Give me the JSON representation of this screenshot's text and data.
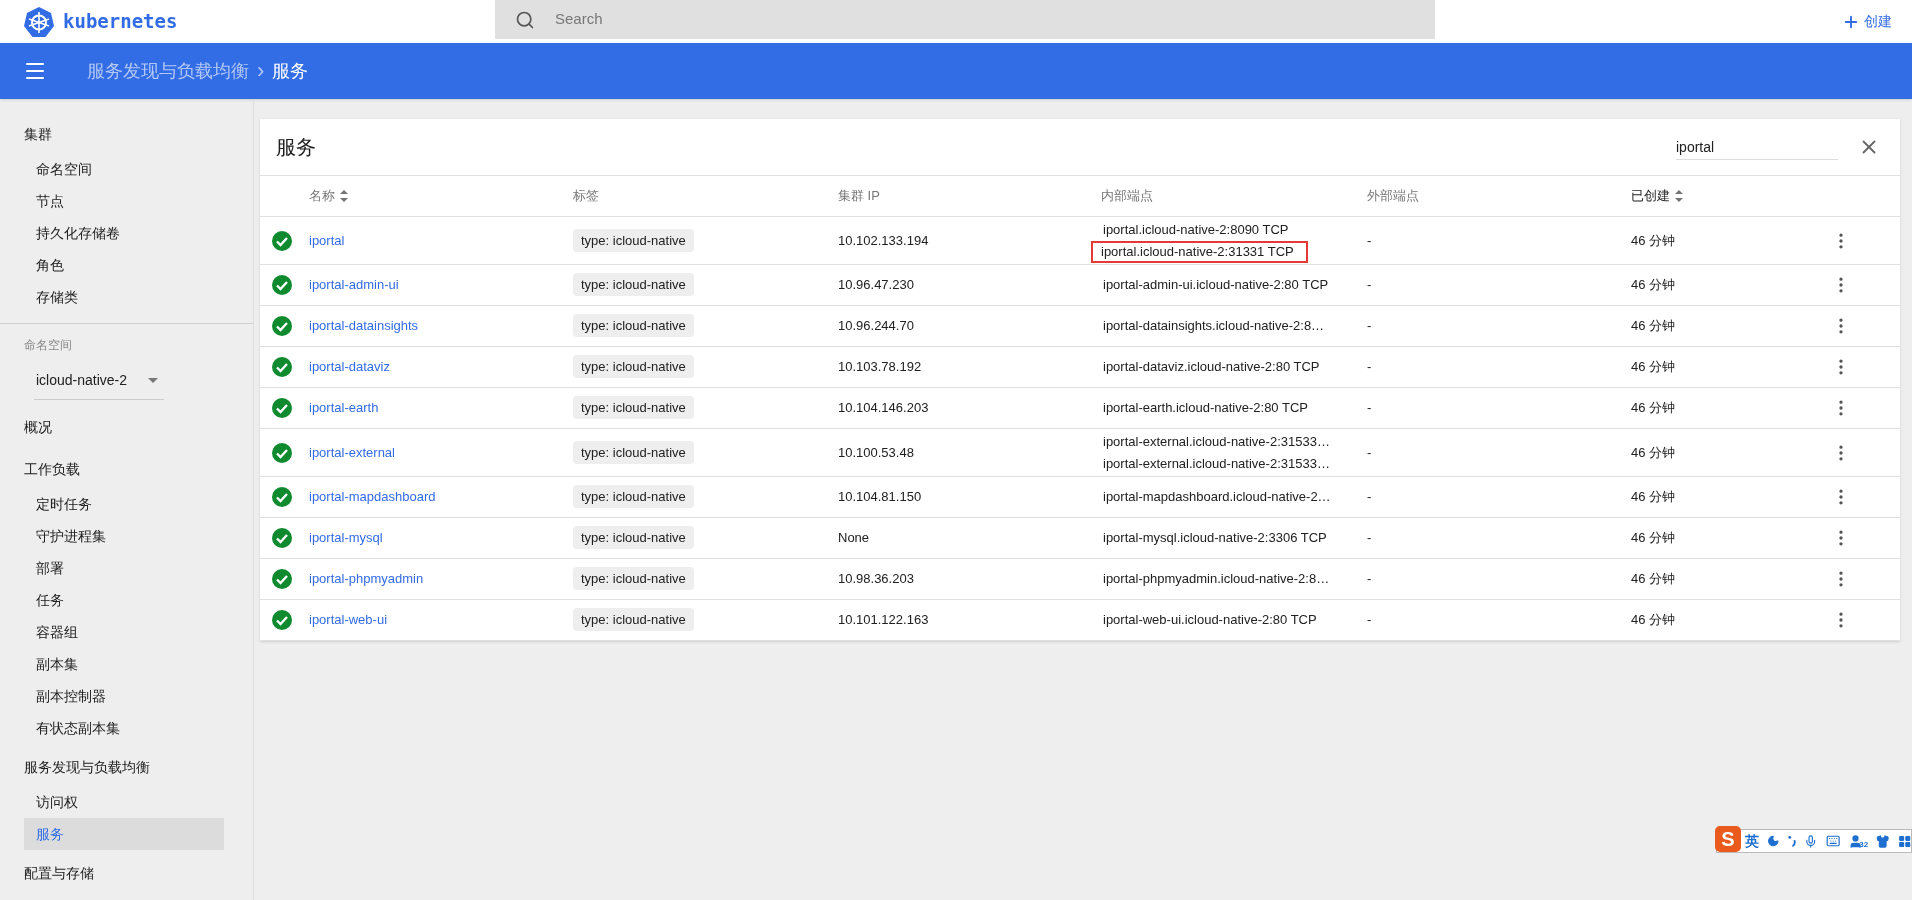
{
  "topbar": {
    "brand": "kubernetes",
    "search": {
      "placeholder": "Search"
    },
    "create": "创建"
  },
  "breadcrumb": {
    "parent": "服务发现与负载均衡",
    "separator": "›",
    "current": "服务"
  },
  "sidebar": {
    "groups": [
      {
        "kind": "section",
        "label": "集群",
        "children": [
          {
            "label": "命名空间",
            "selected": false
          },
          {
            "label": "节点",
            "selected": false
          },
          {
            "label": "持久化存储卷",
            "selected": false
          },
          {
            "label": "角色",
            "selected": false
          },
          {
            "label": "存储类",
            "selected": false
          }
        ]
      },
      {
        "kind": "namespace",
        "label": "命名空间",
        "value": "icloud-native-2"
      },
      {
        "kind": "section",
        "label": "概况"
      },
      {
        "kind": "section",
        "label": "工作负载",
        "children": [
          {
            "label": "定时任务",
            "selected": false
          },
          {
            "label": "守护进程集",
            "selected": false
          },
          {
            "label": "部署",
            "selected": false
          },
          {
            "label": "任务",
            "selected": false
          },
          {
            "label": "容器组",
            "selected": false
          },
          {
            "label": "副本集",
            "selected": false
          },
          {
            "label": "副本控制器",
            "selected": false
          },
          {
            "label": "有状态副本集",
            "selected": false
          }
        ]
      },
      {
        "kind": "section",
        "label": "服务发现与负载均衡",
        "children": [
          {
            "label": "访问权",
            "selected": false
          },
          {
            "label": "服务",
            "selected": true
          }
        ]
      },
      {
        "kind": "section",
        "label": "配置与存储"
      }
    ]
  },
  "card": {
    "title": "服务",
    "filter": {
      "value": "iportal"
    },
    "columns": [
      {
        "label": "名称",
        "sortable": true
      },
      {
        "label": "标签",
        "sortable": false
      },
      {
        "label": "集群 IP",
        "sortable": false
      },
      {
        "label": "内部端点",
        "sortable": false
      },
      {
        "label": "外部端点",
        "sortable": false
      },
      {
        "label": "已创建",
        "sortable": true
      }
    ],
    "rows": [
      {
        "healthy": true,
        "name": "iportal",
        "label": "type: icloud-native",
        "ip": "10.102.133.194",
        "endpoints": [
          {
            "text": "iportal.icloud-native-2:8090 TCP",
            "highlighted": false
          },
          {
            "text": "iportal.icloud-native-2:31331 TCP",
            "highlighted": true
          }
        ],
        "external": "-",
        "created": "46 分钟"
      },
      {
        "healthy": true,
        "name": "iportal-admin-ui",
        "label": "type: icloud-native",
        "ip": "10.96.47.230",
        "endpoints": [
          {
            "text": "iportal-admin-ui.icloud-native-2:80 TCP",
            "highlighted": false
          }
        ],
        "external": "-",
        "created": "46 分钟"
      },
      {
        "healthy": true,
        "name": "iportal-datainsights",
        "label": "type: icloud-native",
        "ip": "10.96.244.70",
        "endpoints": [
          {
            "text": "iportal-datainsights.icloud-native-2:8…",
            "highlighted": false
          }
        ],
        "external": "-",
        "created": "46 分钟"
      },
      {
        "healthy": true,
        "name": "iportal-dataviz",
        "label": "type: icloud-native",
        "ip": "10.103.78.192",
        "endpoints": [
          {
            "text": "iportal-dataviz.icloud-native-2:80 TCP",
            "highlighted": false
          }
        ],
        "external": "-",
        "created": "46 分钟"
      },
      {
        "healthy": true,
        "name": "iportal-earth",
        "label": "type: icloud-native",
        "ip": "10.104.146.203",
        "endpoints": [
          {
            "text": "iportal-earth.icloud-native-2:80 TCP",
            "highlighted": false
          }
        ],
        "external": "-",
        "created": "46 分钟"
      },
      {
        "healthy": true,
        "name": "iportal-external",
        "label": "type: icloud-native",
        "ip": "10.100.53.48",
        "endpoints": [
          {
            "text": "iportal-external.icloud-native-2:31533…",
            "highlighted": false
          },
          {
            "text": "iportal-external.icloud-native-2:31533…",
            "highlighted": false
          }
        ],
        "external": "-",
        "created": "46 分钟"
      },
      {
        "healthy": true,
        "name": "iportal-mapdashboard",
        "label": "type: icloud-native",
        "ip": "10.104.81.150",
        "endpoints": [
          {
            "text": "iportal-mapdashboard.icloud-native-2…",
            "highlighted": false
          }
        ],
        "external": "-",
        "created": "46 分钟"
      },
      {
        "healthy": true,
        "name": "iportal-mysql",
        "label": "type: icloud-native",
        "ip": "None",
        "endpoints": [
          {
            "text": "iportal-mysql.icloud-native-2:3306 TCP",
            "highlighted": false
          }
        ],
        "external": "-",
        "created": "46 分钟"
      },
      {
        "healthy": true,
        "name": "iportal-phpmyadmin",
        "label": "type: icloud-native",
        "ip": "10.98.36.203",
        "endpoints": [
          {
            "text": "iportal-phpmyadmin.icloud-native-2:8…",
            "highlighted": false
          }
        ],
        "external": "-",
        "created": "46 分钟"
      },
      {
        "healthy": true,
        "name": "iportal-web-ui",
        "label": "type: icloud-native",
        "ip": "10.101.122.163",
        "endpoints": [
          {
            "text": "iportal-web-ui.icloud-native-2:80 TCP",
            "highlighted": false
          }
        ],
        "external": "-",
        "created": "46 分钟"
      }
    ]
  },
  "ime_toolbar": {
    "logo": "S",
    "mode": "英",
    "badge": "32"
  }
}
